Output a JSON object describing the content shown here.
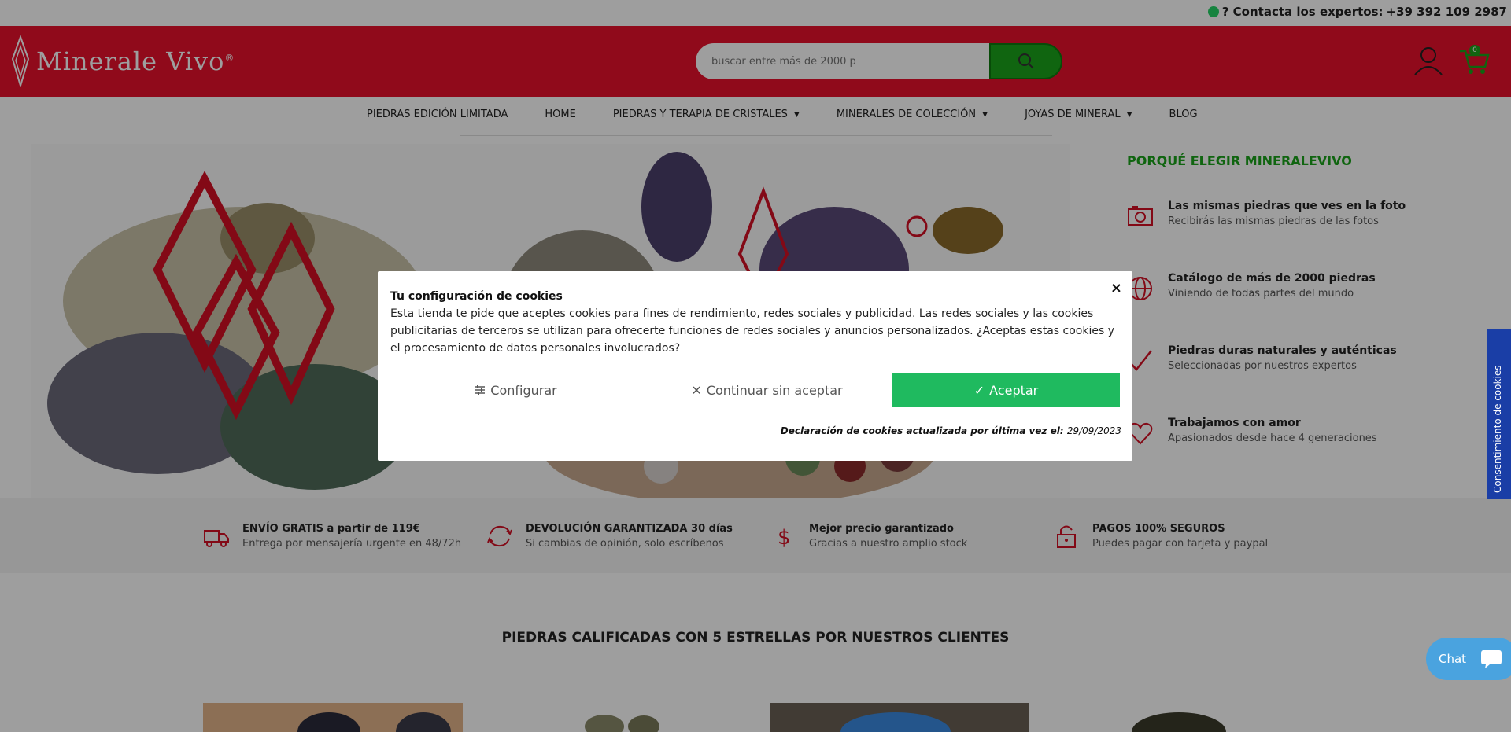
{
  "topbar": {
    "contact_prefix": "? Contacta los expertos:",
    "phone": "+39 392 109 2987"
  },
  "header": {
    "logo_text": "Minerale Vivo",
    "logo_reg": "®",
    "search_placeholder": "buscar entre más de 2000 p",
    "cart_count": "0"
  },
  "nav": {
    "items": [
      {
        "label": "PIEDRAS EDICIÓN LIMITADA",
        "dropdown": false
      },
      {
        "label": "HOME",
        "dropdown": false
      },
      {
        "label": "PIEDRAS Y TERAPIA DE CRISTALES",
        "dropdown": true
      },
      {
        "label": "MINERALES DE COLECCIÓN",
        "dropdown": true
      },
      {
        "label": "JOYAS DE MINERAL",
        "dropdown": true
      },
      {
        "label": "BLOG",
        "dropdown": false
      }
    ]
  },
  "why": {
    "heading": "PORQUÉ ELEGIR MINERALEVIVO",
    "features": [
      {
        "icon": "photo-icon",
        "title": "Las mismas piedras que ves en la foto",
        "subtitle": "Recibirás las mismas piedras de las fotos"
      },
      {
        "icon": "globe-icon",
        "title": "Catálogo de más de 2000 piedras",
        "subtitle": "Viniendo de todas partes del mundo"
      },
      {
        "icon": "check-icon",
        "title": "Piedras duras naturales y auténticas",
        "subtitle": "Seleccionadas por nuestros expertos"
      },
      {
        "icon": "heart-icon",
        "title": "Trabajamos con amor",
        "subtitle": "Apasionados desde hace 4 generaciones"
      }
    ]
  },
  "benefits": [
    {
      "icon": "truck-icon",
      "title": "ENVÍO GRATIS a partir de 119€",
      "subtitle": "Entrega por mensajería urgente en 48/72h"
    },
    {
      "icon": "refresh-icon",
      "title": "DEVOLUCIÓN GARANTIZADA 30 días",
      "subtitle": "Si cambias de opinión, solo escríbenos"
    },
    {
      "icon": "dollar-icon",
      "title": "Mejor precio garantizado",
      "subtitle": "Gracias a nuestro amplio stock"
    },
    {
      "icon": "lock-icon",
      "title": "PAGOS 100% SEGUROS",
      "subtitle": "Puedes pagar con tarjeta y paypal"
    }
  ],
  "section": {
    "title": "PIEDRAS CALIFICADAS CON 5 ESTRELLAS POR NUESTROS CLIENTES"
  },
  "cookie": {
    "title": "Tu configuración de cookies",
    "body": "Esta tienda te pide que aceptes cookies para fines de rendimiento, redes sociales y publicidad. Las redes sociales y las cookies publicitarias de terceros se utilizan para ofrecerte funciones de redes sociales y anuncios personalizados. ¿Aceptas estas cookies y el procesamiento de datos personales involucrados?",
    "configure_label": "Configurar",
    "continue_label": "Continuar sin aceptar",
    "accept_label": "Aceptar",
    "declaration_label": "Declaración de cookies actualizada por última vez el:",
    "declaration_date": "29/09/2023",
    "close_symbol": "×"
  },
  "side_tab": {
    "label": "Consentimiento de cookies"
  },
  "chat": {
    "label": "Chat"
  },
  "colors": {
    "brand_red": "#e8112d",
    "green": "#1aa31a",
    "accept_green": "#1fba5f",
    "side_tab_blue": "#1a3ea6",
    "chat_blue": "#4aa3df"
  }
}
